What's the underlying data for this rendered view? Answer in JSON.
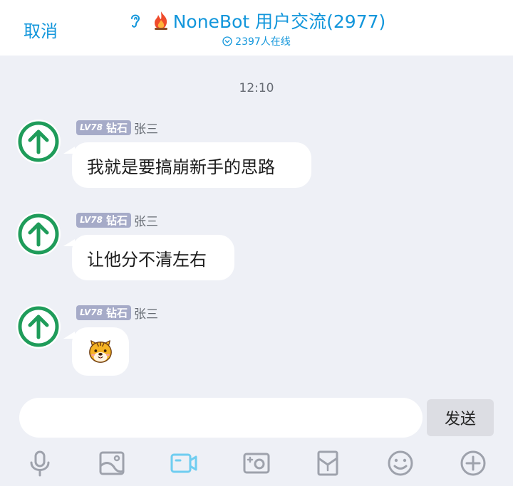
{
  "header": {
    "cancel_label": "取消",
    "title": "NoneBot 用户交流(2977)",
    "online_text": "2397人在线"
  },
  "timestamp": "12:10",
  "messages": [
    {
      "level": "LV78",
      "rank": "钻石",
      "sender": "张三",
      "text": "我就是要搞崩新手的思路"
    },
    {
      "level": "LV78",
      "rank": "钻石",
      "sender": "张三",
      "text": "让他分不清左右"
    },
    {
      "level": "LV78",
      "rank": "钻石",
      "sender": "张三",
      "text": "",
      "content_icon": "tiger-face-emoji"
    }
  ],
  "composer": {
    "input_value": "",
    "send_label": "发送"
  },
  "toolbar": {
    "icons": [
      "microphone-icon",
      "image-icon",
      "video-icon",
      "camera-icon",
      "red-packet-icon",
      "emoji-icon",
      "plus-icon"
    ],
    "active_icon": "video-icon"
  },
  "colors": {
    "accent": "#1296db",
    "avatar_green": "#1f9c5a",
    "badge": "#a6abc8",
    "background": "#eef0f6"
  }
}
